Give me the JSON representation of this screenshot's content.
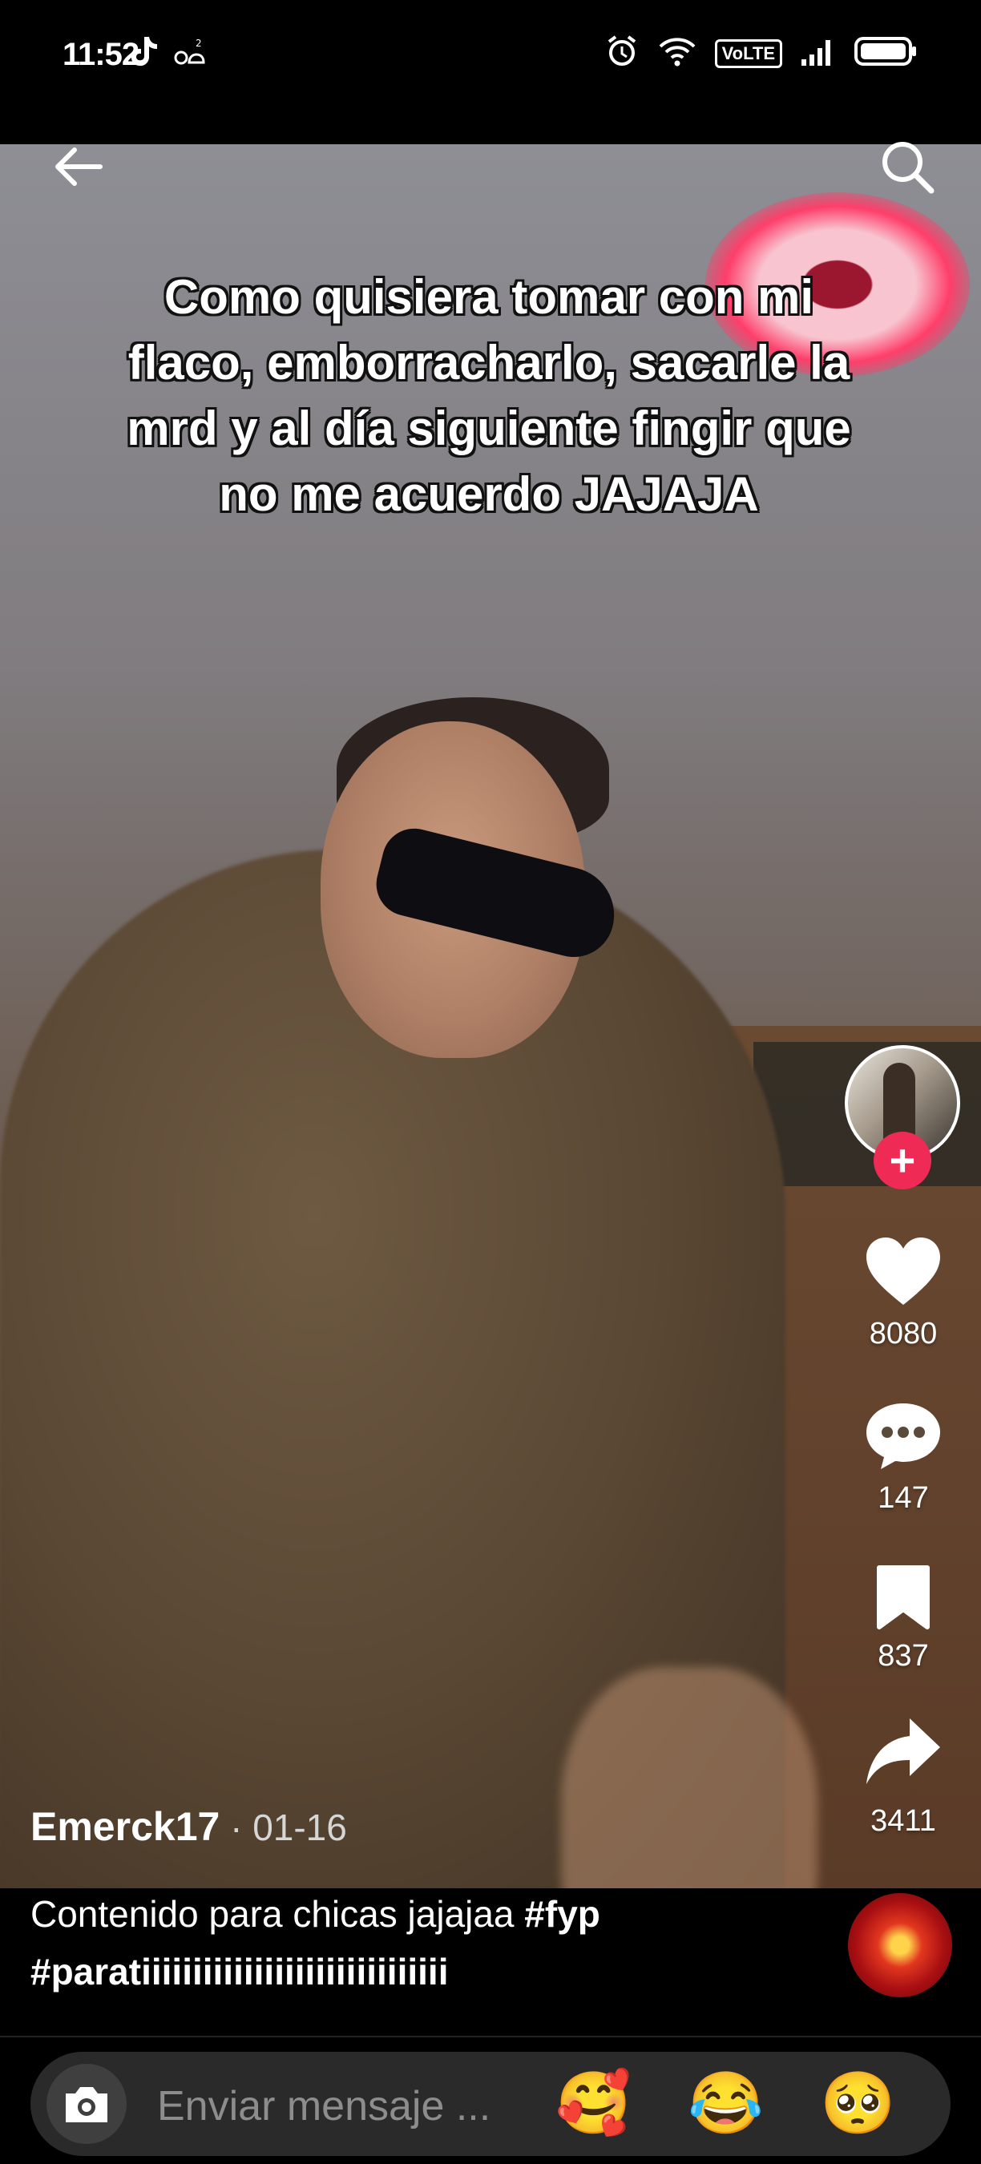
{
  "status_bar": {
    "time": "11:52",
    "left_icons": [
      "tiktok-icon",
      "notification-icon"
    ],
    "volte": "VoLTE",
    "right_icons": [
      "alarm-icon",
      "wifi-icon",
      "volte-icon",
      "signal-icon",
      "battery-icon"
    ]
  },
  "nav": {
    "back_icon": "back-arrow-icon",
    "search_icon": "search-icon"
  },
  "video": {
    "overlay_text": "Como quisiera tomar con mi flaco, emborracharlo, sacarle la mrd y al día siguiente fingir que no me acuerdo JAJAJA"
  },
  "rail": {
    "likes": "8080",
    "comments": "147",
    "saves": "837",
    "shares": "3411"
  },
  "post": {
    "author": "Emerck17",
    "date": " · 01-16",
    "caption_text": "Contenido para chicas jajajaa ",
    "hashtag1": "#fyp",
    "hashtag2": "#paratiiiiiiiiiiiiiiiiiiiiiiiiiiiiii"
  },
  "message_bar": {
    "placeholder": "Enviar mensaje ...",
    "emojis": [
      "🥰",
      "😂",
      "🥺"
    ]
  }
}
